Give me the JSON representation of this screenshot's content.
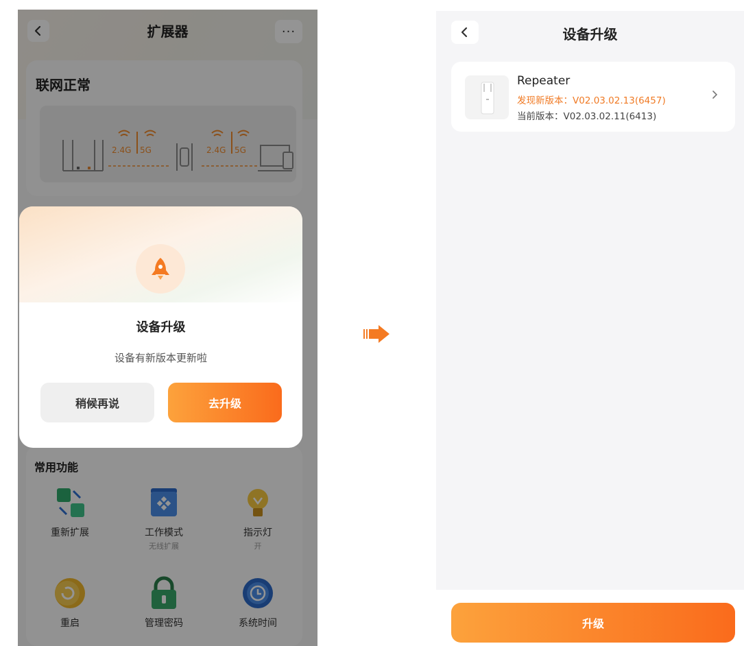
{
  "left": {
    "header": {
      "title": "扩展器",
      "more": "···"
    },
    "status": {
      "title": "联网正常",
      "band_1": "2.4G",
      "band_2": "5G",
      "band_3": "2.4G",
      "band_4": "5G"
    },
    "dialog": {
      "title": "设备升级",
      "description": "设备有新版本更新啦",
      "later_label": "稍候再说",
      "upgrade_label": "去升级"
    },
    "functions": {
      "title": "常用功能",
      "items": [
        {
          "label": "重新扩展",
          "sub": ""
        },
        {
          "label": "工作模式",
          "sub": "无线扩展"
        },
        {
          "label": "指示灯",
          "sub": "开"
        },
        {
          "label": "重启",
          "sub": ""
        },
        {
          "label": "管理密码",
          "sub": ""
        },
        {
          "label": "系统时间",
          "sub": ""
        }
      ]
    }
  },
  "right": {
    "header": {
      "title": "设备升级"
    },
    "device": {
      "name": "Repeater",
      "new_version": "发现新版本：V02.03.02.13(6457)",
      "current_version": "当前版本：V02.03.02.11(6413)"
    },
    "upgrade_label": "升级"
  },
  "colors": {
    "accent": "#fa6b1c",
    "accent_light": "#fca23c",
    "orange_text": "#f07a24"
  }
}
